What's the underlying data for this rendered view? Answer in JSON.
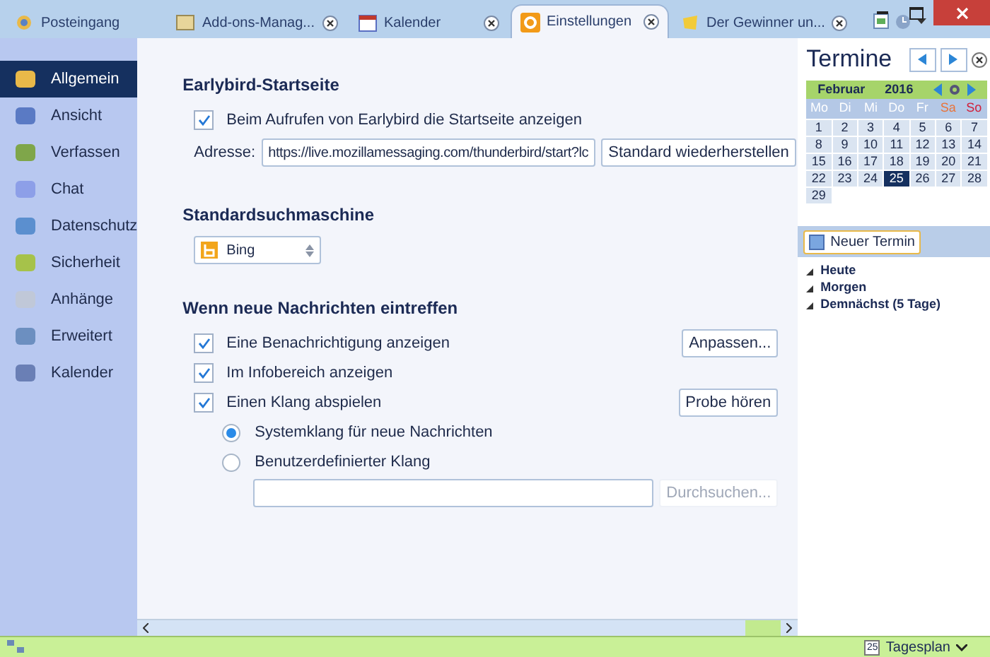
{
  "tabs": [
    {
      "label": "Posteingang",
      "selected": false,
      "closable": false
    },
    {
      "label": "Add-ons-Manag...",
      "selected": false,
      "closable": true
    },
    {
      "label": "Kalender",
      "selected": false,
      "closable": true
    },
    {
      "label": "Einstellungen",
      "selected": true,
      "closable": true
    },
    {
      "label": "Der Gewinner un...",
      "selected": false,
      "closable": true
    }
  ],
  "sidebar": {
    "items": [
      {
        "label": "Allgemein",
        "selected": true
      },
      {
        "label": "Ansicht",
        "selected": false
      },
      {
        "label": "Verfassen",
        "selected": false
      },
      {
        "label": "Chat",
        "selected": false
      },
      {
        "label": "Datenschutz",
        "selected": false
      },
      {
        "label": "Sicherheit",
        "selected": false
      },
      {
        "label": "Anhänge",
        "selected": false
      },
      {
        "label": "Erweitert",
        "selected": false
      },
      {
        "label": "Kalender",
        "selected": false
      }
    ]
  },
  "startpage": {
    "heading": "Earlybird-Startseite",
    "checkbox": {
      "label": "Beim Aufrufen von Earlybird die Startseite anzeigen",
      "checked": true
    },
    "address_label": "Adresse:",
    "address": "https://live.mozillamessaging.com/thunderbird/start?lc",
    "restore_button": "Standard wiederherstellen"
  },
  "search": {
    "heading": "Standardsuchmaschine",
    "engine": "Bing"
  },
  "new_mail": {
    "heading": "Wenn neue Nachrichten eintreffen",
    "options": [
      {
        "label": "Eine Benachrichtigung anzeigen",
        "checked": true,
        "button": "Anpassen..."
      },
      {
        "label": "Im Infobereich anzeigen",
        "checked": true
      },
      {
        "label": "Einen Klang abspielen",
        "checked": true,
        "button": "Probe hören"
      }
    ],
    "sounds": [
      {
        "label": "Systemklang für neue Nachrichten",
        "selected": true
      },
      {
        "label": "Benutzerdefinierter Klang",
        "selected": false
      }
    ],
    "browse_button": {
      "label": "Durchsuchen...",
      "disabled": true
    }
  },
  "agenda": {
    "title": "Termine",
    "month": "Februar",
    "year": "2016",
    "weekdays": [
      {
        "label": "Mo",
        "color": "#ffffff"
      },
      {
        "label": "Di",
        "color": "#ffffff"
      },
      {
        "label": "Mi",
        "color": "#ffffff"
      },
      {
        "label": "Do",
        "color": "#ffffff"
      },
      {
        "label": "Fr",
        "color": "#ffffff"
      },
      {
        "label": "Sa",
        "color": "#e8743b"
      },
      {
        "label": "So",
        "color": "#d0203c"
      }
    ],
    "days": [
      {
        "label": "1",
        "selected": false
      },
      {
        "label": "2",
        "selected": false
      },
      {
        "label": "3",
        "selected": false
      },
      {
        "label": "4",
        "selected": false
      },
      {
        "label": "5",
        "selected": false
      },
      {
        "label": "6",
        "selected": false
      },
      {
        "label": "7",
        "selected": false
      },
      {
        "label": "8",
        "selected": false
      },
      {
        "label": "9",
        "selected": false
      },
      {
        "label": "10",
        "selected": false
      },
      {
        "label": "11",
        "selected": false
      },
      {
        "label": "12",
        "selected": false
      },
      {
        "label": "13",
        "selected": false
      },
      {
        "label": "14",
        "selected": false
      },
      {
        "label": "15",
        "selected": false
      },
      {
        "label": "16",
        "selected": false
      },
      {
        "label": "17",
        "selected": false
      },
      {
        "label": "18",
        "selected": false
      },
      {
        "label": "19",
        "selected": false
      },
      {
        "label": "20",
        "selected": false
      },
      {
        "label": "21",
        "selected": false
      },
      {
        "label": "22",
        "selected": false
      },
      {
        "label": "23",
        "selected": false
      },
      {
        "label": "24",
        "selected": false
      },
      {
        "label": "25",
        "selected": true
      },
      {
        "label": "26",
        "selected": false
      },
      {
        "label": "27",
        "selected": false
      },
      {
        "label": "28",
        "selected": false
      },
      {
        "label": "29",
        "selected": false
      }
    ],
    "new_button": "Neuer Termin",
    "groups": [
      {
        "label": "Heute",
        "expanded": true
      },
      {
        "label": "Morgen",
        "expanded": true
      },
      {
        "label": "Demnächst (5 Tage)",
        "expanded": true
      }
    ]
  },
  "status_bar": {
    "date_icon": "25",
    "view": "Tagesplan"
  }
}
